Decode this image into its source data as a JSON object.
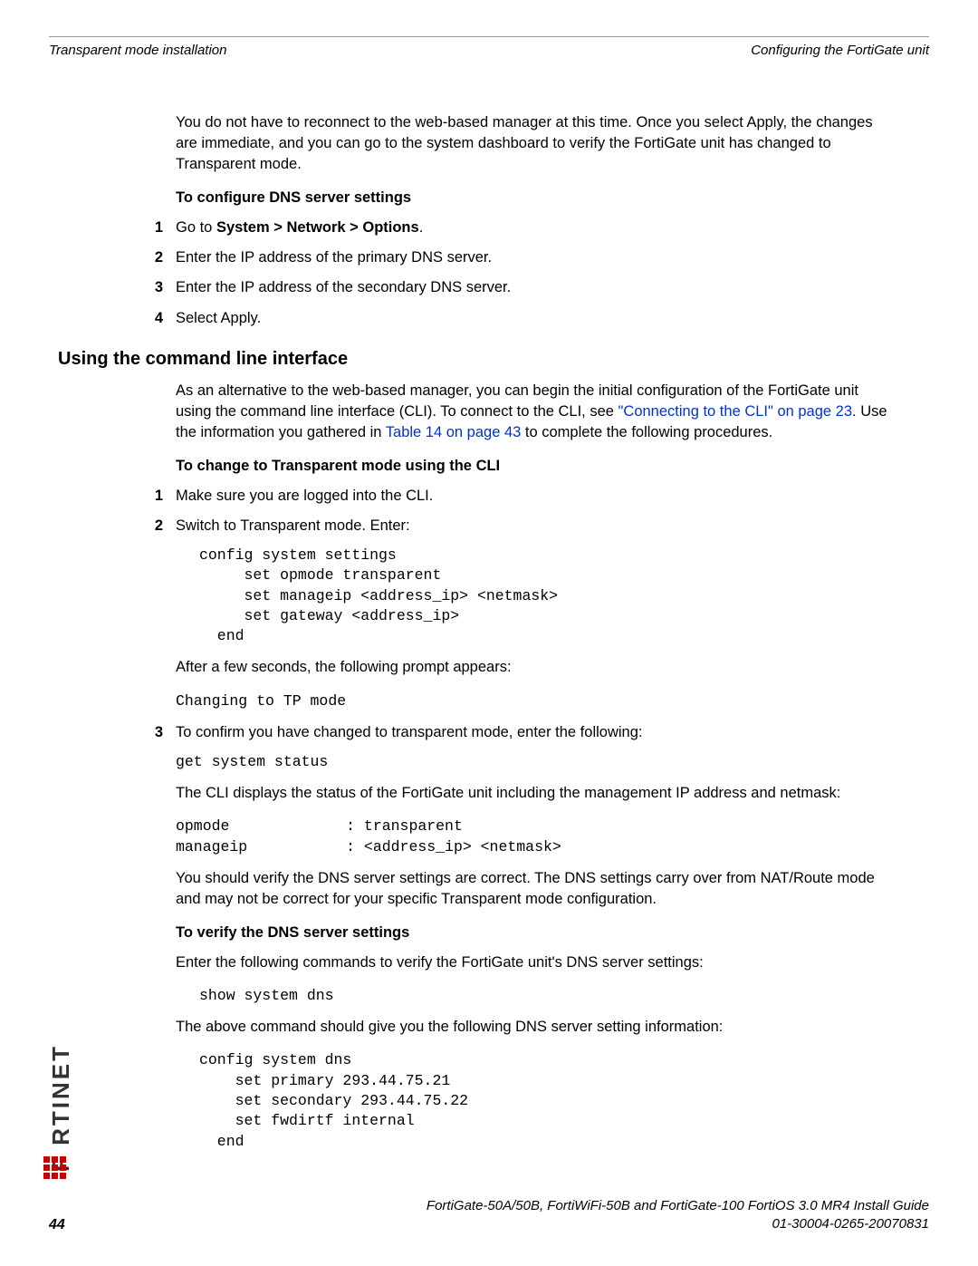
{
  "header": {
    "left": "Transparent mode installation",
    "right": "Configuring the FortiGate unit"
  },
  "intro_para": "You do not have to reconnect to the web-based manager at this time. Once you select Apply, the changes are immediate, and you can go to the system dashboard to verify the FortiGate unit has changed to Transparent mode.",
  "dns_heading": "To configure DNS server settings",
  "dns_steps": {
    "s1_prefix": "Go to ",
    "s1_bold": "System > Network > Options",
    "s1_suffix": ".",
    "s2": "Enter the IP address of the primary DNS server.",
    "s3": "Enter the IP address of the secondary DNS server.",
    "s4": "Select Apply."
  },
  "cli_section_heading": "Using the command line interface",
  "cli_intro_p1a": "As an alternative to the web-based manager, you can begin the initial configuration of the FortiGate unit using the command line interface (CLI). To connect to the CLI, see ",
  "cli_intro_link1": "\"Connecting to the CLI\" on page 23",
  "cli_intro_p1b": ". Use the information you gathered in ",
  "cli_intro_link2": "Table 14 on page 43",
  "cli_intro_p1c": " to complete the following procedures.",
  "cli_transparent_heading": "To change to Transparent mode using the CLI",
  "cli_steps": {
    "s1": "Make sure you are logged into the CLI.",
    "s2": "Switch to Transparent mode. Enter:",
    "s3": "To confirm you have changed to transparent mode, enter the following:"
  },
  "code_block1": "config system settings\n     set opmode transparent\n     set manageip <address_ip> <netmask>\n     set gateway <address_ip>\n  end",
  "after_seconds": "After a few seconds, the following prompt appears:",
  "code_changing": "Changing to TP mode",
  "code_get_status": "get system status",
  "cli_displays": "The CLI displays the status of the FortiGate unit including the management IP address and netmask:",
  "code_opmode": "opmode             : transparent\nmanageip           : <address_ip> <netmask>",
  "verify_para": "You should verify the DNS server settings are correct. The DNS settings carry over from NAT/Route mode and may not be correct for your specific Transparent mode configuration.",
  "verify_heading": "To verify the DNS server settings",
  "verify_cmd_para": "Enter the following commands to verify the FortiGate unit's DNS server settings:",
  "code_show_dns": "show system dns",
  "above_cmd_para": "The above command should give you the following DNS server setting information:",
  "code_config_dns": "config system dns\n    set primary 293.44.75.21\n    set secondary 293.44.75.22\n    set fwdirtf internal\n  end",
  "footer": {
    "line1": "FortiGate-50A/50B, FortiWiFi-50B and FortiGate-100 FortiOS 3.0 MR4 Install Guide",
    "line2": "01-30004-0265-20070831",
    "page": "44"
  },
  "logo_text": "F   RTINET"
}
